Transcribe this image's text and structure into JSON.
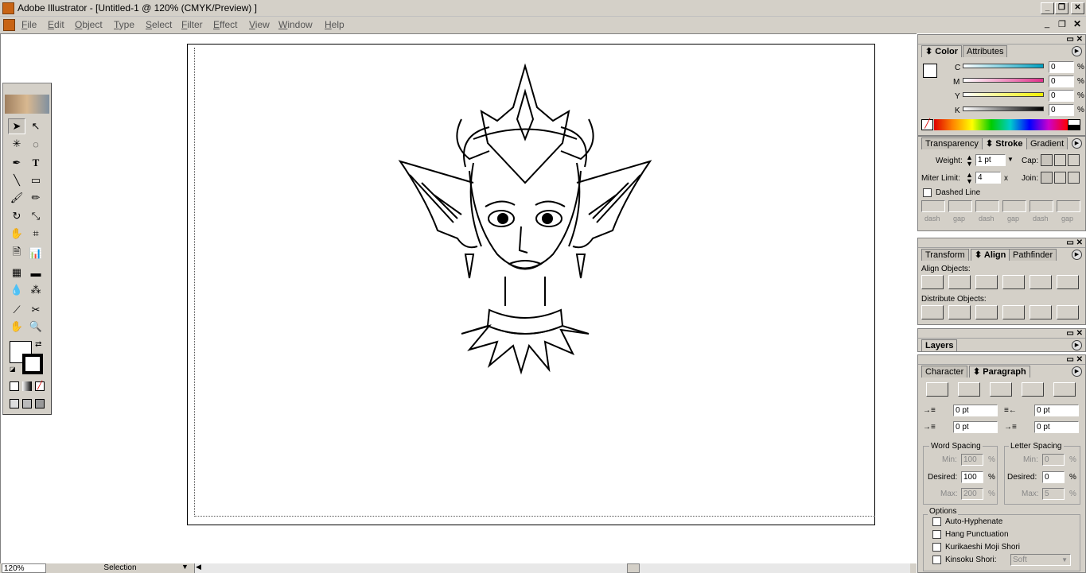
{
  "window": {
    "title": "Adobe Illustrator - [Untitled-1 @ 120% (CMYK/Preview) ]"
  },
  "menu": [
    "File",
    "Edit",
    "Object",
    "Type",
    "Select",
    "Filter",
    "Effect",
    "View",
    "Window",
    "Help"
  ],
  "color_panel": {
    "tabs": [
      "Color",
      "Attributes"
    ],
    "channels": [
      {
        "label": "C",
        "value": "0",
        "unit": "%",
        "color": "#00a0c0"
      },
      {
        "label": "M",
        "value": "0",
        "unit": "%",
        "color": "#e0308a"
      },
      {
        "label": "Y",
        "value": "0",
        "unit": "%",
        "color": "#f0f000"
      },
      {
        "label": "K",
        "value": "0",
        "unit": "%",
        "color": "#000000"
      }
    ]
  },
  "stroke_panel": {
    "tabs": [
      "Transparency",
      "Stroke",
      "Gradient"
    ],
    "weight_label": "Weight:",
    "weight_value": "1 pt",
    "cap_label": "Cap:",
    "miter_label": "Miter Limit:",
    "miter_value": "4",
    "miter_unit": "x",
    "join_label": "Join:",
    "dashed_label": "Dashed Line",
    "dash_labels": [
      "dash",
      "gap",
      "dash",
      "gap",
      "dash",
      "gap"
    ]
  },
  "align_panel": {
    "tabs": [
      "Transform",
      "Align",
      "Pathfinder"
    ],
    "align_objects": "Align Objects:",
    "distribute_objects": "Distribute Objects:"
  },
  "layers_panel": {
    "tab": "Layers"
  },
  "paragraph_panel": {
    "tabs": [
      "Character",
      "Paragraph"
    ],
    "indents": [
      "0 pt",
      "0 pt",
      "0 pt",
      "0 pt"
    ],
    "word_spacing": {
      "title": "Word Spacing",
      "min_label": "Min:",
      "min": "100",
      "desired_label": "Desired:",
      "desired": "100",
      "max_label": "Max:",
      "max": "200",
      "unit": "%"
    },
    "letter_spacing": {
      "title": "Letter Spacing",
      "min_label": "Min:",
      "min": "0",
      "desired_label": "Desired:",
      "desired": "0",
      "max_label": "Max:",
      "max": "5",
      "unit": "%"
    },
    "options_title": "Options",
    "options": [
      "Auto-Hyphenate",
      "Hang Punctuation",
      "Kurikaeshi Moji Shori",
      "Kinsoku Shori:"
    ],
    "kinsoku_value": "Soft"
  },
  "status": {
    "zoom": "120%",
    "mode": "Selection"
  }
}
